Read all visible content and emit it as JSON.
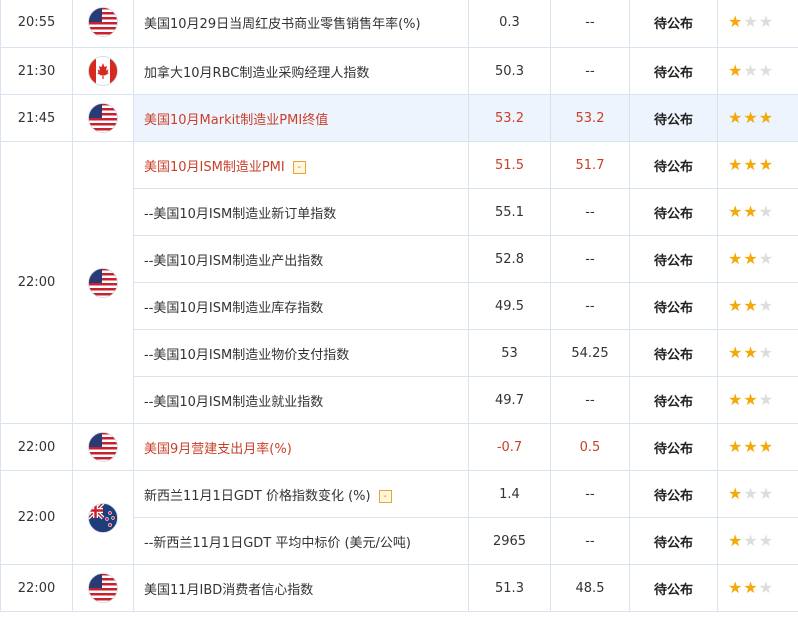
{
  "colors": {
    "highlight": "#c9402a",
    "star_on": "#f3a90a",
    "star_off": "#dddddd",
    "border": "#d9e3ef",
    "selected_bg": "#eef4fd"
  },
  "groups": [
    {
      "time": "20:55",
      "flag": "us-flag-icon",
      "rows": [
        {
          "name": "美国10月29日当周红皮书商业零售销售年率(%)",
          "actual": "0.3",
          "forecast": "--",
          "status": "待公布",
          "stars": 1,
          "highlight": false,
          "expand": false
        }
      ]
    },
    {
      "time": "21:30",
      "flag": "ca-flag-icon",
      "rows": [
        {
          "name": "加拿大10月RBC制造业采购经理人指数",
          "actual": "50.3",
          "forecast": "--",
          "status": "待公布",
          "stars": 1,
          "highlight": false,
          "expand": false
        }
      ]
    },
    {
      "time": "21:45",
      "flag": "us-flag-icon",
      "selected": true,
      "rows": [
        {
          "name": "美国10月Markit制造业PMI终值",
          "actual": "53.2",
          "forecast": "53.2",
          "status": "待公布",
          "stars": 3,
          "highlight": true,
          "expand": false
        }
      ]
    },
    {
      "time": "22:00",
      "flag": "us-flag-icon",
      "rows": [
        {
          "name": "美国10月ISM制造业PMI",
          "actual": "51.5",
          "forecast": "51.7",
          "status": "待公布",
          "stars": 3,
          "highlight": true,
          "expand": true,
          "expand_label": "-"
        },
        {
          "name": "--美国10月ISM制造业新订单指数",
          "actual": "55.1",
          "forecast": "--",
          "status": "待公布",
          "stars": 2,
          "highlight": false,
          "expand": false
        },
        {
          "name": "--美国10月ISM制造业产出指数",
          "actual": "52.8",
          "forecast": "--",
          "status": "待公布",
          "stars": 2,
          "highlight": false,
          "expand": false
        },
        {
          "name": "--美国10月ISM制造业库存指数",
          "actual": "49.5",
          "forecast": "--",
          "status": "待公布",
          "stars": 2,
          "highlight": false,
          "expand": false
        },
        {
          "name": "--美国10月ISM制造业物价支付指数",
          "actual": "53",
          "forecast": "54.25",
          "status": "待公布",
          "stars": 2,
          "highlight": false,
          "expand": false
        },
        {
          "name": "--美国10月ISM制造业就业指数",
          "actual": "49.7",
          "forecast": "--",
          "status": "待公布",
          "stars": 2,
          "highlight": false,
          "expand": false
        }
      ]
    },
    {
      "time": "22:00",
      "flag": "us-flag-icon",
      "rows": [
        {
          "name": "美国9月营建支出月率(%)",
          "actual": "-0.7",
          "forecast": "0.5",
          "status": "待公布",
          "stars": 3,
          "highlight": true,
          "expand": false
        }
      ]
    },
    {
      "time": "22:00",
      "flag": "nz-flag-icon",
      "rows": [
        {
          "name": "新西兰11月1日GDT 价格指数变化 (%)",
          "actual": "1.4",
          "forecast": "--",
          "status": "待公布",
          "stars": 1,
          "highlight": false,
          "expand": true,
          "expand_label": "-"
        },
        {
          "name": "--新西兰11月1日GDT 平均中标价 (美元/公吨)",
          "actual": "2965",
          "forecast": "--",
          "status": "待公布",
          "stars": 1,
          "highlight": false,
          "expand": false
        }
      ]
    },
    {
      "time": "22:00",
      "flag": "us-flag-icon",
      "rows": [
        {
          "name": "美国11月IBD消费者信心指数",
          "actual": "51.3",
          "forecast": "48.5",
          "status": "待公布",
          "stars": 2,
          "highlight": false,
          "expand": false
        }
      ]
    }
  ]
}
